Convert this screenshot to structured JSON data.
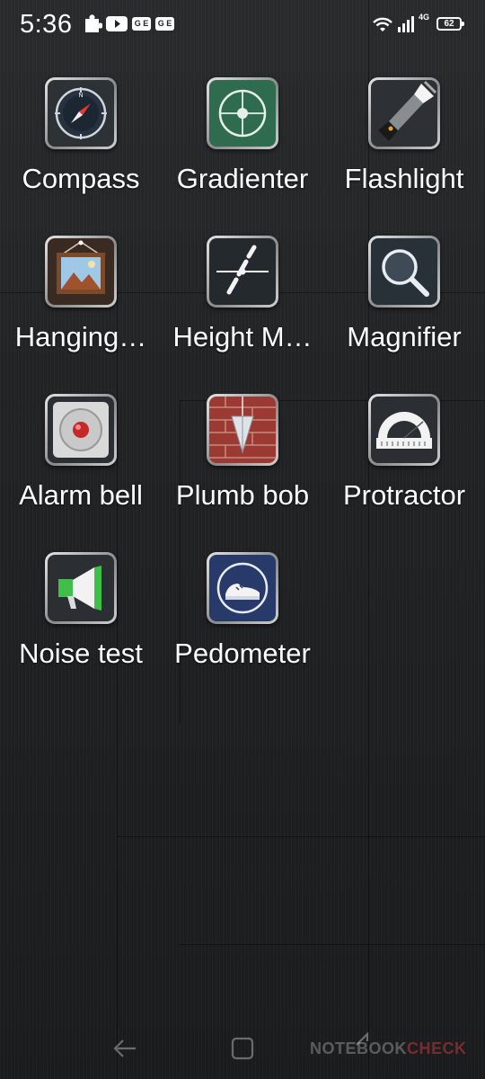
{
  "status_bar": {
    "time": "5:36",
    "badge_1": "G E",
    "badge_2": "G E",
    "network_label": "4G",
    "battery_level": "62"
  },
  "apps": [
    {
      "label": "Compass"
    },
    {
      "label": "Gradienter"
    },
    {
      "label": "Flashlight"
    },
    {
      "label": "Hanging…"
    },
    {
      "label": "Height M…"
    },
    {
      "label": "Magnifier"
    },
    {
      "label": "Alarm bell"
    },
    {
      "label": "Plumb bob"
    },
    {
      "label": "Protractor"
    },
    {
      "label": "Noise test"
    },
    {
      "label": "Pedometer"
    }
  ],
  "watermark": {
    "prefix": "NOTEBOOK",
    "suffix": "CHECK"
  }
}
